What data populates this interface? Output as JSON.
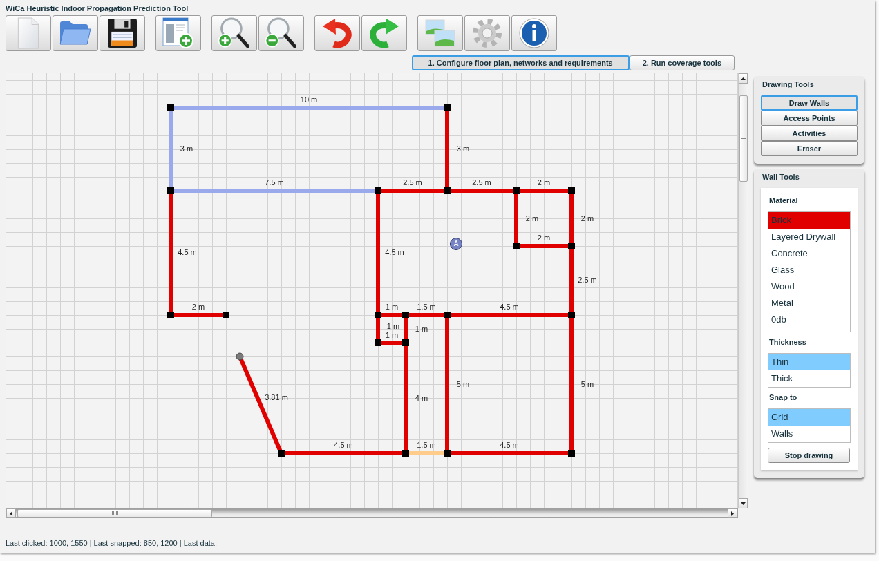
{
  "window": {
    "title": "WiCa Heuristic Indoor Propagation Prediction Tool"
  },
  "tabs": [
    {
      "label": "1. Configure floor plan, networks and requirements",
      "selected": true
    },
    {
      "label": "2. Run coverage tools",
      "selected": false
    }
  ],
  "floor_plan": {
    "walls": [
      {
        "label": "10 m",
        "color": "#9aa8ec"
      },
      {
        "label": "3 m",
        "color": "#9aa8ec"
      },
      {
        "label": "3 m",
        "color": "#e00000"
      },
      {
        "label": "7.5 m",
        "color": "#9aa8ec"
      },
      {
        "label": "2.5 m",
        "color": "#e00000"
      },
      {
        "label": "2.5 m",
        "color": "#e00000"
      },
      {
        "label": "2 m",
        "color": "#e00000"
      },
      {
        "label": "2 m",
        "color": "#e00000"
      },
      {
        "label": "2 m",
        "color": "#e00000"
      },
      {
        "label": "2 m",
        "color": "#e00000"
      },
      {
        "label": "4.5 m",
        "color": "#e00000"
      },
      {
        "label": "4.5 m",
        "color": "#e00000"
      },
      {
        "label": "2.5 m",
        "color": "#e00000"
      },
      {
        "label": "2 m",
        "color": "#e00000"
      },
      {
        "label": "1 m",
        "color": "#e00000"
      },
      {
        "label": "1.5 m",
        "color": "#e00000"
      },
      {
        "label": "4.5 m",
        "color": "#e00000"
      },
      {
        "label": "1 m",
        "color": "#e00000"
      },
      {
        "label": "1 m",
        "color": "#e00000"
      },
      {
        "label": "1 m",
        "color": "#e00000"
      },
      {
        "label": "4 m",
        "color": "#e00000"
      },
      {
        "label": "5 m",
        "color": "#e00000"
      },
      {
        "label": "5 m",
        "color": "#e00000"
      },
      {
        "label": "4.5 m",
        "color": "#e00000"
      },
      {
        "label": "1.5 m",
        "color": "#ffcc8c"
      },
      {
        "label": "4.5 m",
        "color": "#e00000"
      },
      {
        "label": "3.81 m",
        "color": "#e00000"
      }
    ],
    "access_points": [
      {
        "label": "A"
      }
    ]
  },
  "drawing_tools": {
    "title": "Drawing Tools",
    "buttons": [
      {
        "label": "Draw Walls",
        "selected": true
      },
      {
        "label": "Access Points",
        "selected": false
      },
      {
        "label": "Activities",
        "selected": false
      },
      {
        "label": "Eraser",
        "selected": false
      }
    ]
  },
  "wall_tools": {
    "title": "Wall Tools",
    "sections": [
      {
        "label": "Material",
        "options": [
          {
            "label": "Brick",
            "selected": true
          },
          {
            "label": "Layered Drywall",
            "selected": false
          },
          {
            "label": "Concrete",
            "selected": false
          },
          {
            "label": "Glass",
            "selected": false
          },
          {
            "label": "Wood",
            "selected": false
          },
          {
            "label": "Metal",
            "selected": false
          },
          {
            "label": "0db",
            "selected": false
          }
        ]
      },
      {
        "label": "Thickness",
        "options": [
          {
            "label": "Thin",
            "selected": true
          },
          {
            "label": "Thick",
            "selected": false
          }
        ]
      },
      {
        "label": "Snap to",
        "options": [
          {
            "label": "Grid",
            "selected": true
          },
          {
            "label": "Walls",
            "selected": false
          }
        ]
      }
    ],
    "button": "Stop drawing"
  },
  "status_bar": {
    "text": "Last clicked: 1000, 1550 | Last snapped: 850, 1200 | Last data:"
  }
}
